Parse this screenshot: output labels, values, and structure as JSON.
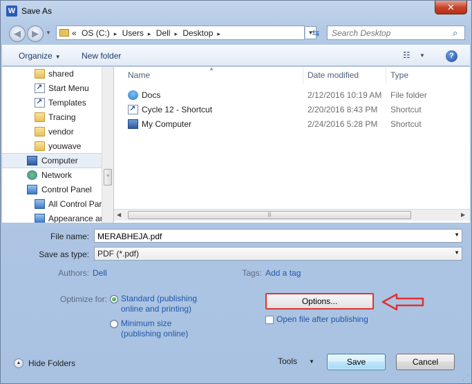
{
  "window": {
    "title": "Save As",
    "app_icon_letter": "W",
    "close_glyph": "✕"
  },
  "address": {
    "overflow": "«",
    "crumbs": [
      "OS (C:)",
      "Users",
      "Dell",
      "Desktop"
    ],
    "separator": "▸",
    "search_placeholder": "Search Desktop"
  },
  "toolbar": {
    "organize": "Organize",
    "new_folder": "New folder",
    "help": "?"
  },
  "nav": {
    "items": [
      {
        "label": "shared",
        "icon": "folder-icon",
        "indent": 1
      },
      {
        "label": "Start Menu",
        "icon": "shortcut-icon",
        "indent": 1
      },
      {
        "label": "Templates",
        "icon": "shortcut-icon",
        "indent": 1
      },
      {
        "label": "Tracing",
        "icon": "folder-icon",
        "indent": 1
      },
      {
        "label": "vendor",
        "icon": "folder-icon",
        "indent": 1
      },
      {
        "label": "youwave",
        "icon": "folder-icon",
        "indent": 1
      },
      {
        "label": "Computer",
        "icon": "computer-icon",
        "indent": 0
      },
      {
        "label": "Network",
        "icon": "network-icon",
        "indent": 0
      },
      {
        "label": "Control Panel",
        "icon": "control-panel-icon",
        "indent": 0
      },
      {
        "label": "All Control Par",
        "icon": "control-panel-icon",
        "indent": 1
      },
      {
        "label": "Appearance ar",
        "icon": "control-panel-icon",
        "indent": 1
      }
    ]
  },
  "files": {
    "columns": {
      "name": "Name",
      "date": "Date modified",
      "type": "Type"
    },
    "rows": [
      {
        "name": "Docs",
        "date": "2/12/2016 10:19 AM",
        "type": "File folder",
        "icon": "docs-folder-icon"
      },
      {
        "name": "Cycle 12 - Shortcut",
        "date": "2/20/2016 8:43 PM",
        "type": "Shortcut",
        "icon": "shortcut-icon"
      },
      {
        "name": "My Computer",
        "date": "2/24/2016 5:28 PM",
        "type": "Shortcut",
        "icon": "computer-shortcut-icon"
      }
    ]
  },
  "form": {
    "file_name_label": "File name:",
    "file_name_value": "MERABHEJA.pdf",
    "save_type_label": "Save as type:",
    "save_type_value": "PDF (*.pdf)",
    "authors_label": "Authors:",
    "authors_value": "Dell",
    "tags_label": "Tags:",
    "tags_value": "Add a tag",
    "optimize_label": "Optimize for:",
    "optimize_standard_line1": "Standard (publishing",
    "optimize_standard_line2": "online and printing)",
    "optimize_min_line1": "Minimum size",
    "optimize_min_line2": "(publishing online)",
    "options_button": "Options...",
    "open_after_label": "Open file after publishing",
    "optimize_selected": "standard",
    "highlight_color": "#e03232"
  },
  "footer": {
    "hide_folders": "Hide Folders",
    "tools": "Tools",
    "save": "Save",
    "cancel": "Cancel"
  }
}
